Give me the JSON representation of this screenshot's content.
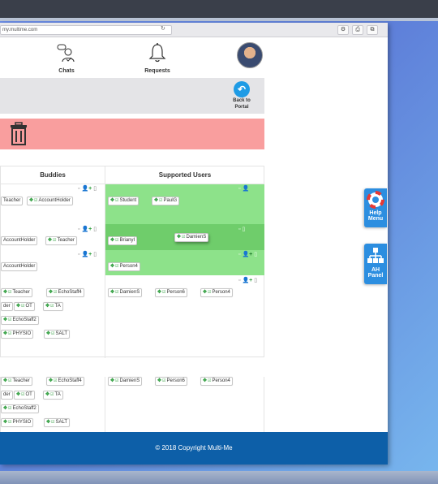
{
  "browser": {
    "url": "my.multime.com",
    "reload": "↻",
    "buttons": [
      "⚙",
      "⎙",
      "⧉"
    ]
  },
  "header": {
    "chats_label": "Chats",
    "requests_label": "Requests"
  },
  "portal": {
    "back_label_1": "Back to",
    "back_label_2": "Portal"
  },
  "table": {
    "buddies_header": "Buddies",
    "supported_header": "Supported Users",
    "buddy_rows": [
      [
        "Teacher",
        "AccountHolder"
      ],
      [
        "AccountHolder",
        "Teacher"
      ],
      [
        "AccountHolder"
      ],
      [
        "Teacher",
        "EchoStaff4"
      ],
      [
        "der",
        "OT",
        "TA"
      ],
      [
        "EchoStaff2"
      ],
      [
        "PHYSIO",
        "SALT"
      ]
    ],
    "supported_rows": [
      [
        "Student",
        "PaulG"
      ],
      [
        "BrianyI"
      ],
      [
        "DamienS"
      ],
      [
        "Person4"
      ],
      [
        "DamienS",
        "Person6",
        "Person4"
      ]
    ]
  },
  "bottom": {
    "buddy_rows": [
      [
        "Teacher",
        "EchoStaff4"
      ],
      [
        "der",
        "OT",
        "TA"
      ],
      [
        "EchoStaff2"
      ],
      [
        "PHYSIO",
        "SALT"
      ]
    ],
    "supported_rows": [
      [
        "DamienS",
        "Person6",
        "Person4"
      ]
    ]
  },
  "footer": {
    "copyright": "© 2018 Copyright Multi-Me"
  },
  "side": {
    "help_1": "Help",
    "help_2": "Menu",
    "ah_1": "AH",
    "ah_2": "Panel"
  },
  "colors": {
    "accent": "#1e9be5",
    "footer": "#0d5fa8",
    "delete_zone": "#f99e9e",
    "green_zone": "#8de28a"
  }
}
